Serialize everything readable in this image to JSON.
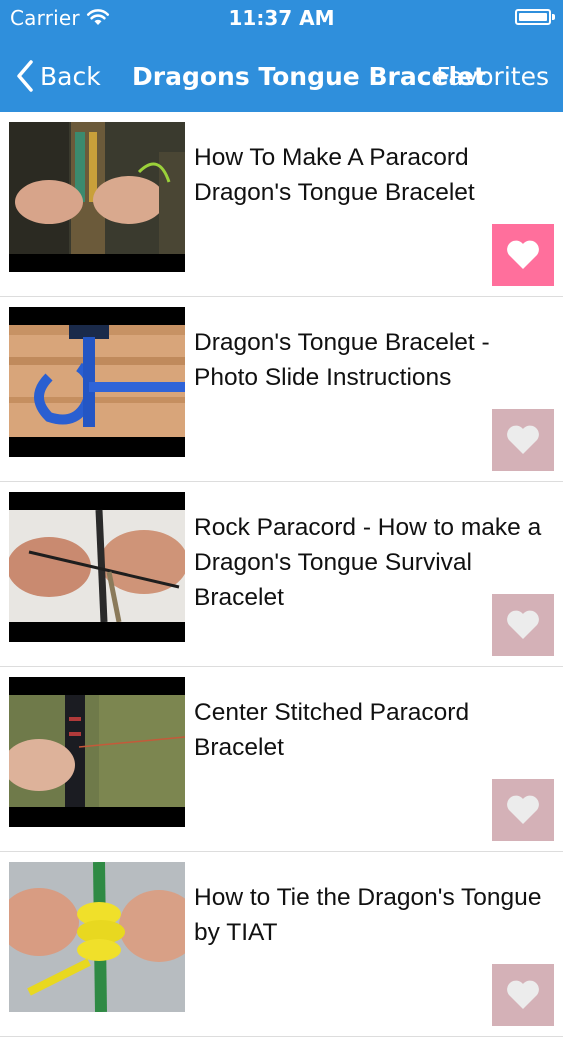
{
  "status_bar": {
    "carrier": "Carrier",
    "time": "11:37 AM"
  },
  "nav": {
    "back_label": "Back",
    "title": "Dragons Tongue Bracelet",
    "favorites_label": "Favorites"
  },
  "colors": {
    "header_bg": "#2f8fdc",
    "favorite_active": "#ff6f9c",
    "favorite_inactive": "#d4b1b7"
  },
  "items": [
    {
      "title": "How To Make A Paracord Dragon's Tongue Bracelet",
      "favorited": true
    },
    {
      "title": "Dragon's Tongue Bracelet - Photo Slide Instructions",
      "favorited": false
    },
    {
      "title": "Rock Paracord - How to make a Dragon's Tongue Survival Bracelet",
      "favorited": false
    },
    {
      "title": "Center Stitched Paracord Bracelet",
      "favorited": false
    },
    {
      "title": "How to Tie the Dragon's Tongue by TIAT",
      "favorited": false
    }
  ]
}
